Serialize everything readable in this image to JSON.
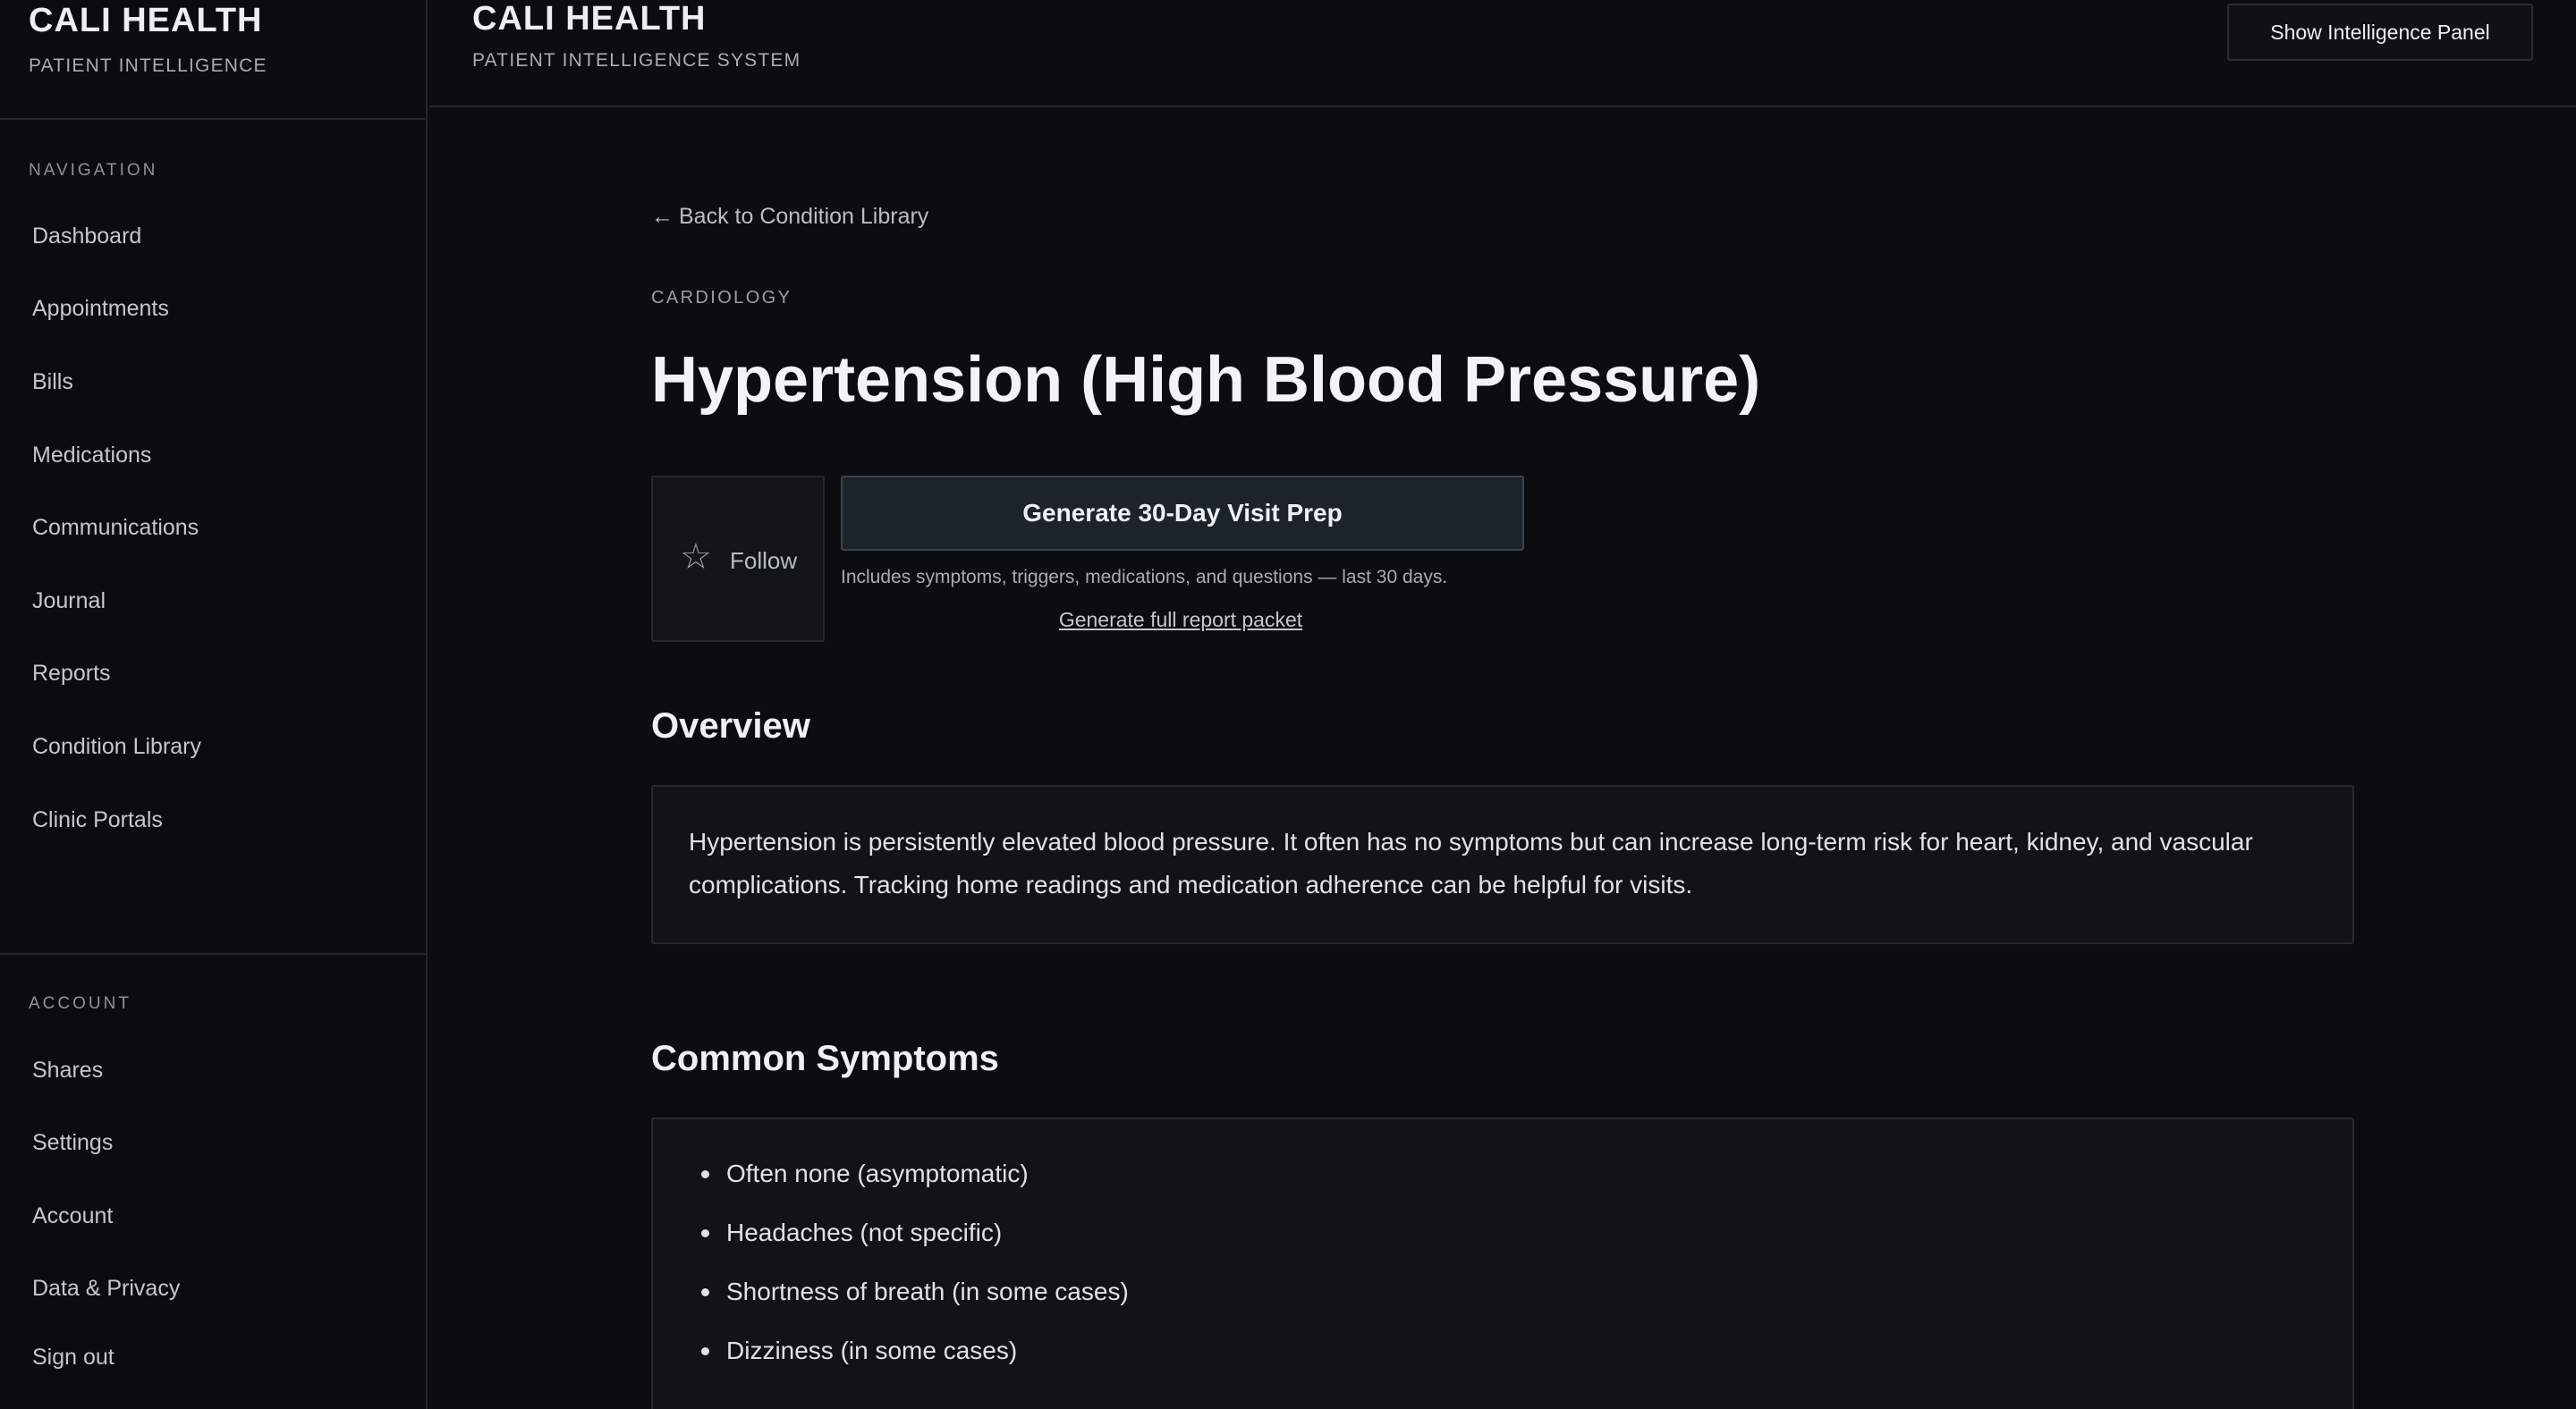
{
  "sidebar": {
    "brand_title": "CALI HEALTH",
    "brand_subtitle": "PATIENT INTELLIGENCE",
    "nav_heading": "NAVIGATION",
    "nav_items": [
      {
        "label": "Dashboard"
      },
      {
        "label": "Appointments"
      },
      {
        "label": "Bills"
      },
      {
        "label": "Medications"
      },
      {
        "label": "Communications"
      },
      {
        "label": "Journal"
      },
      {
        "label": "Reports"
      },
      {
        "label": "Condition Library"
      },
      {
        "label": "Clinic Portals"
      }
    ],
    "account_heading": "ACCOUNT",
    "account_items": [
      {
        "label": "Shares"
      },
      {
        "label": "Settings"
      },
      {
        "label": "Account"
      },
      {
        "label": "Data & Privacy"
      },
      {
        "label": "Sign out"
      }
    ]
  },
  "header": {
    "title": "CALI HEALTH",
    "subtitle": "PATIENT INTELLIGENCE SYSTEM",
    "panel_button": "Show Intelligence Panel"
  },
  "main": {
    "back_link": "Back to Condition Library",
    "specialty": "CARDIOLOGY",
    "title": "Hypertension (High Blood Pressure)",
    "follow_label": "Follow",
    "generate_button": "Generate 30-Day Visit Prep",
    "generate_note": "Includes symptoms, triggers, medications, and questions — last 30 days.",
    "full_report_link": "Generate full report packet",
    "overview_heading": "Overview",
    "overview_text": "Hypertension is persistently elevated blood pressure. It often has no symptoms but can increase long-term risk for heart, kidney, and vascular complications. Tracking home readings and medication adherence can be helpful for visits.",
    "symptoms_heading": "Common Symptoms",
    "symptoms": [
      "Often none (asymptomatic)",
      "Headaches (not specific)",
      "Shortness of breath (in some cases)",
      "Dizziness (in some cases)"
    ]
  },
  "icons": {
    "back": "arrow-left-icon",
    "follow": "star-icon"
  }
}
